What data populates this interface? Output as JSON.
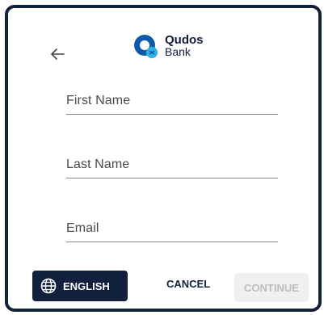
{
  "header": {
    "back_icon": "arrow-left-icon",
    "logo_name": "Qudos",
    "logo_sub": "Bank",
    "brand_color": "#0f5aa8",
    "accent_color": "#2fb0e6"
  },
  "form": {
    "fields": [
      {
        "label": "First Name",
        "value": ""
      },
      {
        "label": "Last Name",
        "value": ""
      },
      {
        "label": "Email",
        "value": ""
      }
    ]
  },
  "footer": {
    "language_label": "ENGLISH",
    "language_icon": "globe-icon",
    "cancel_label": "CANCEL",
    "continue_label": "CONTINUE",
    "continue_disabled": true,
    "dark_color": "#10203d"
  }
}
